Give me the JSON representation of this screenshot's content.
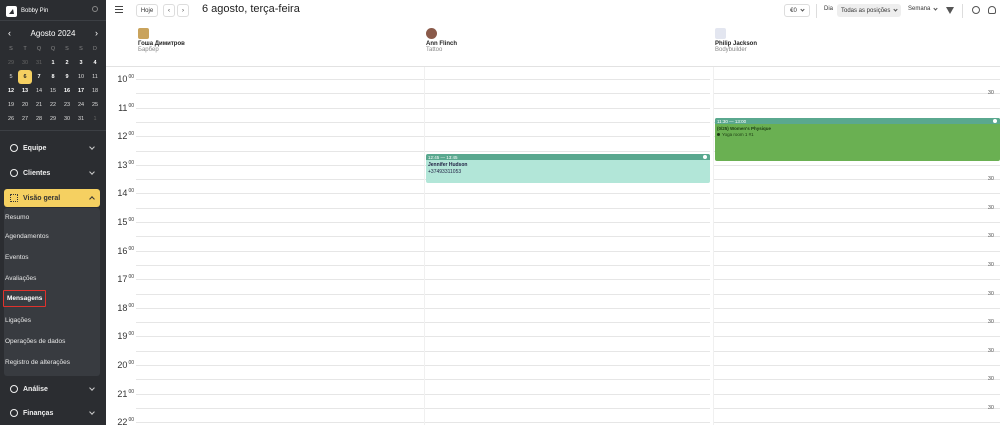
{
  "sidebar": {
    "brand": "Bobby Pin",
    "month": "Agosto 2024",
    "weekdays": [
      "S",
      "T",
      "Q",
      "Q",
      "S",
      "S",
      "D"
    ],
    "weeks": [
      [
        "29",
        "30",
        "31",
        "1",
        "2",
        "3",
        "4"
      ],
      [
        "5",
        "6",
        "7",
        "8",
        "9",
        "10",
        "11"
      ],
      [
        "12",
        "13",
        "14",
        "15",
        "16",
        "17",
        "18"
      ],
      [
        "19",
        "20",
        "21",
        "22",
        "23",
        "24",
        "25"
      ],
      [
        "26",
        "27",
        "28",
        "29",
        "30",
        "31",
        "1"
      ]
    ],
    "sections": {
      "equipe": "Equipe",
      "clientes": "Clientes",
      "visao_geral": "Visão geral",
      "analise": "Análise",
      "financas": "Finanças"
    },
    "subitems": [
      "Resumo",
      "Agendamentos",
      "Eventos",
      "Avaliações",
      "Mensagens",
      "Ligações",
      "Operações de dados",
      "Registro de alterações"
    ]
  },
  "toolbar": {
    "today": "Hoje",
    "prev": "‹",
    "next": "›",
    "date_title": "6 agosto, terça-feira",
    "currency": "€0",
    "day": "Dia",
    "positions": "Todas as posições",
    "week": "Semana"
  },
  "staff": [
    {
      "name": "Гоша Димитров",
      "role": "Барбер"
    },
    {
      "name": "Ann Flinch",
      "role": "Tattoo"
    },
    {
      "name": "Philip Jackson",
      "role": "Bodybuilder"
    }
  ],
  "time_labels": [
    {
      "hour": "10",
      "min": "00",
      "half": "30"
    },
    {
      "hour": "11",
      "min": "00",
      "half": "30"
    },
    {
      "hour": "12",
      "min": "00",
      "half": "30"
    },
    {
      "hour": "13",
      "min": "00",
      "half": "30"
    },
    {
      "hour": "14",
      "min": "00",
      "half": "30"
    },
    {
      "hour": "15",
      "min": "00",
      "half": "30"
    },
    {
      "hour": "16",
      "min": "00",
      "half": "30"
    },
    {
      "hour": "17",
      "min": "00",
      "half": "30"
    },
    {
      "hour": "18",
      "min": "00",
      "half": "30"
    },
    {
      "hour": "19",
      "min": "00",
      "half": "30"
    },
    {
      "hour": "20",
      "min": "00",
      "half": "30"
    },
    {
      "hour": "21",
      "min": "00",
      "half": "30"
    },
    {
      "hour": "22",
      "min": "00",
      "half": ""
    }
  ],
  "appointments": [
    {
      "time": "12:45 — 13:45",
      "client": "Jennifer Hudson",
      "phone": "+37493311053",
      "colors": {
        "head": "#5aa88f",
        "body": "#b2e6d8"
      }
    },
    {
      "time": "11:30 — 13:00",
      "title": "(0/25) Women's Physique",
      "subtitle": "Yoga room 1 #1",
      "colors": {
        "head": "#5aa88f",
        "body": "#6ab052"
      }
    }
  ],
  "colors": {
    "accent": "#f5d061",
    "sidebar": "#2b2d31",
    "highlight_border": "#e0322c"
  }
}
